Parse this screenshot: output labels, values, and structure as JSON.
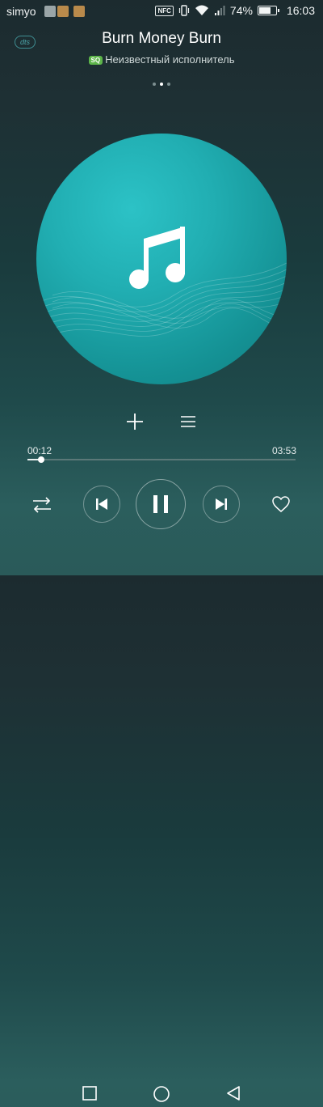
{
  "status_bar": {
    "carrier": "simyo",
    "nfc_label": "NFC",
    "battery_text": "74%",
    "battery_level": 0.74,
    "time": "16:03",
    "icons": [
      "notification-icon",
      "notification-icon",
      "notification-icon",
      "nfc-icon",
      "vibrate-icon",
      "wifi-icon",
      "signal-icon",
      "battery-icon"
    ]
  },
  "header": {
    "dts_label": "dts",
    "song_title": "Burn Money Burn",
    "quality_badge": "SQ",
    "artist": "Неизвестный исполнитель",
    "page_dots": 3,
    "active_page": 1
  },
  "album_art": {
    "icon": "music-note-icon"
  },
  "actions": {
    "add_icon": "plus-icon",
    "list_icon": "playlist-icon"
  },
  "progress": {
    "current_time": "00:12",
    "total_time": "03:53",
    "fraction": 0.05
  },
  "controls": {
    "shuffle_icon": "shuffle-icon",
    "prev_icon": "previous-icon",
    "play_state": "playing",
    "pause_icon": "pause-icon",
    "next_icon": "next-icon",
    "favorite_icon": "heart-icon"
  },
  "nav_bar": {
    "items": [
      "recent-apps-icon",
      "home-icon",
      "back-icon"
    ]
  },
  "colors": {
    "accent": "#21aeb2",
    "sq_badge": "#5db54a",
    "background_top": "#1c2b2f",
    "background_bottom": "#2a5a59"
  }
}
